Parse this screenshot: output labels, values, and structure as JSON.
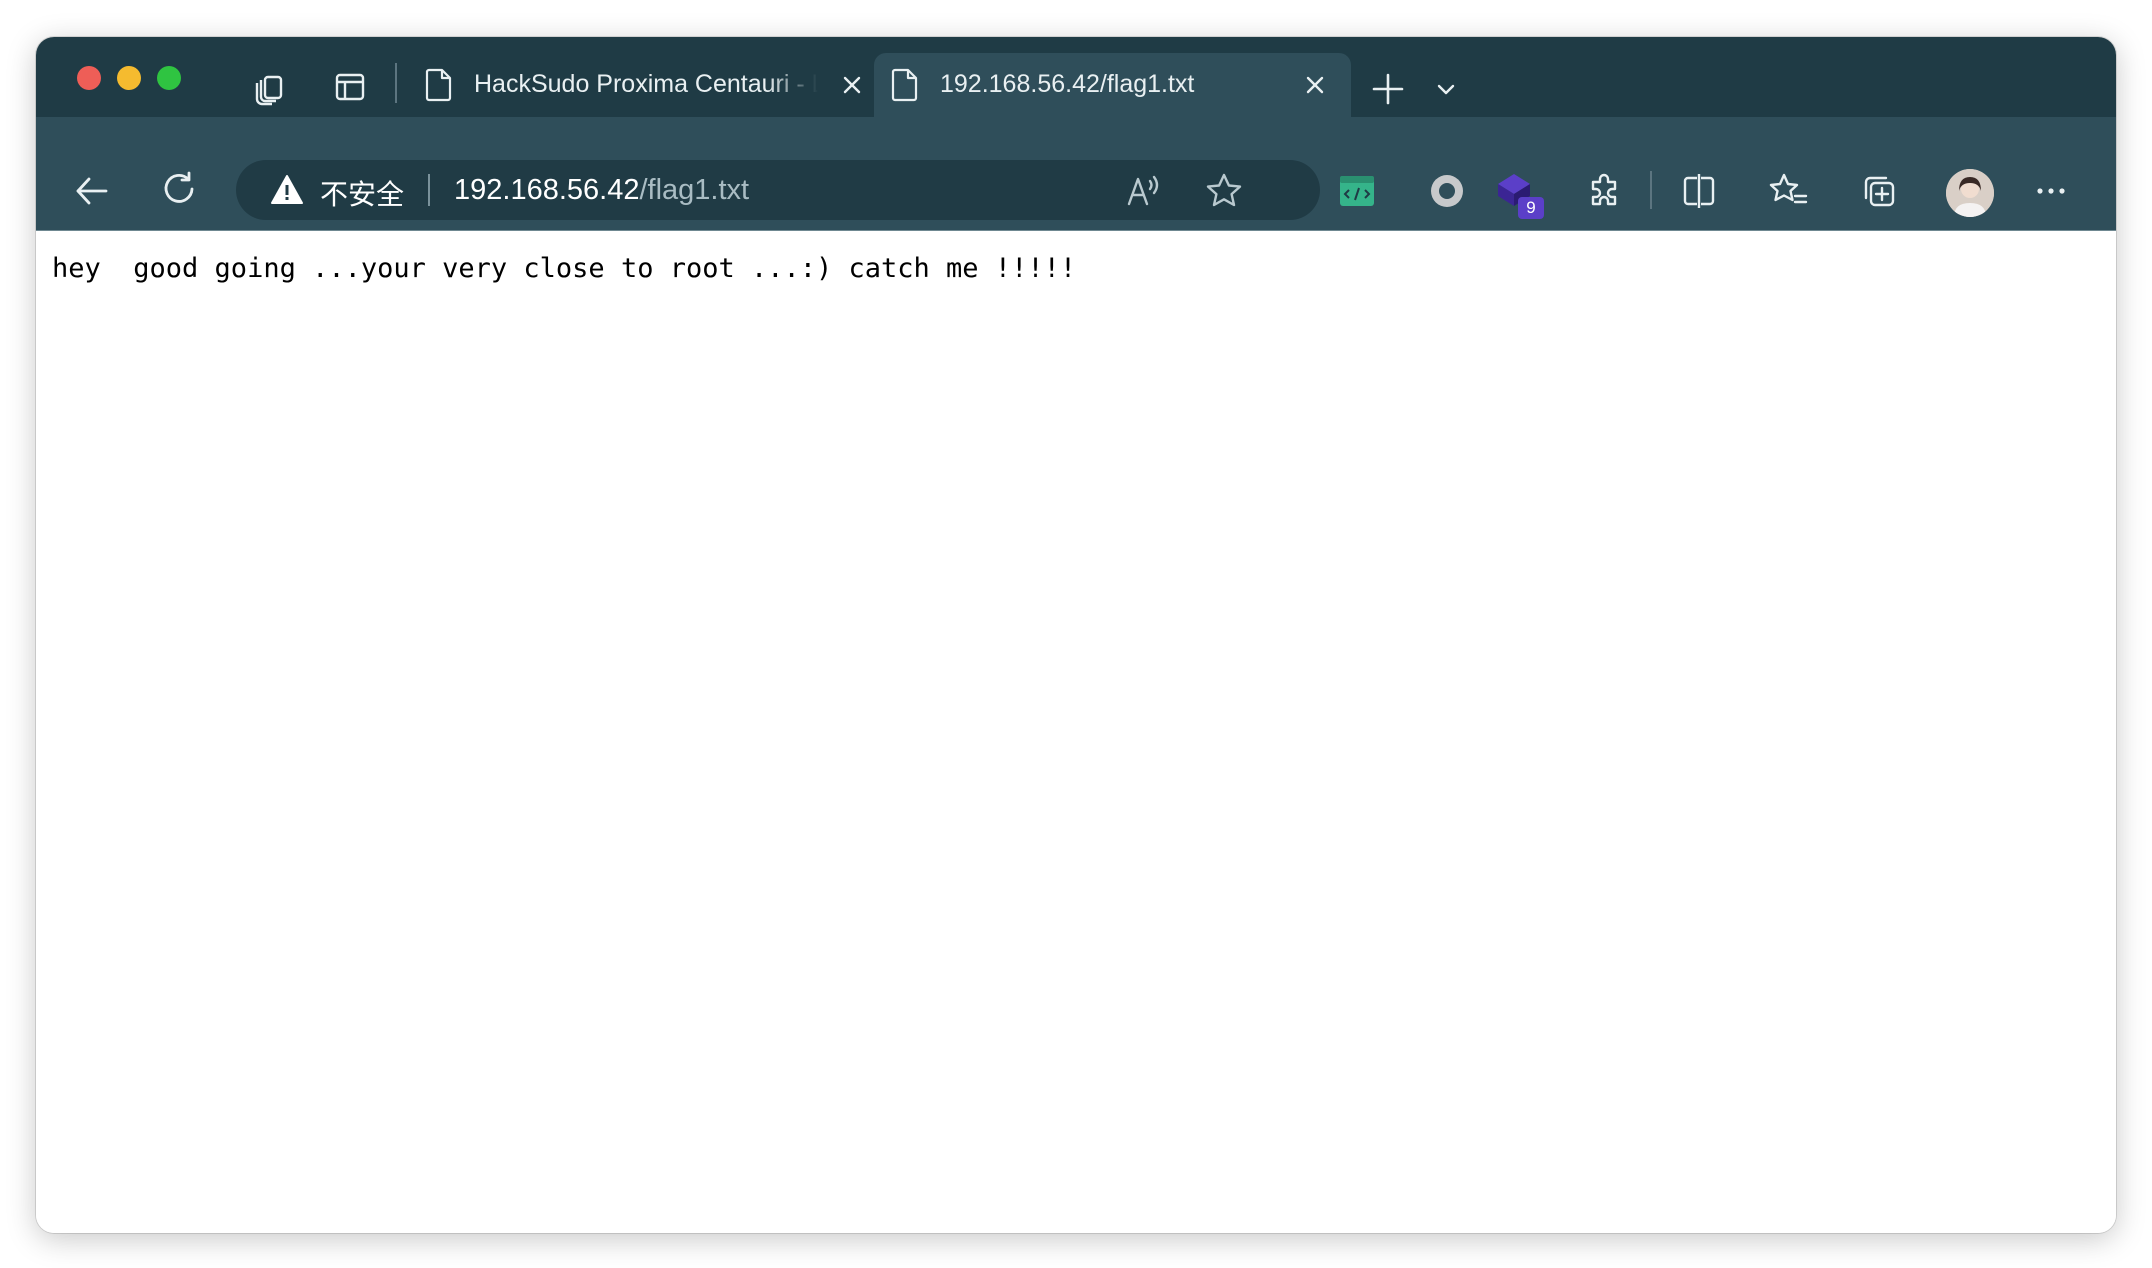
{
  "colors": {
    "tab_strip": "#1f3b45",
    "toolbar": "#2f4e5a",
    "omnibox": "#203b45",
    "badge": "#5b3fc8"
  },
  "tabs": [
    {
      "title": "HackSudo Proxima Centauri - L",
      "icon": "page-icon",
      "active": false
    },
    {
      "title": "192.168.56.42/flag1.txt",
      "icon": "page-icon",
      "active": true
    }
  ],
  "omnibox": {
    "security_label": "不安全",
    "url_host": "192.168.56.42",
    "url_path": "/flag1.txt"
  },
  "extensions": {
    "badge_count": "9"
  },
  "page": {
    "text": "hey  good going ...your very close to root ...:) catch me !!!!!"
  }
}
